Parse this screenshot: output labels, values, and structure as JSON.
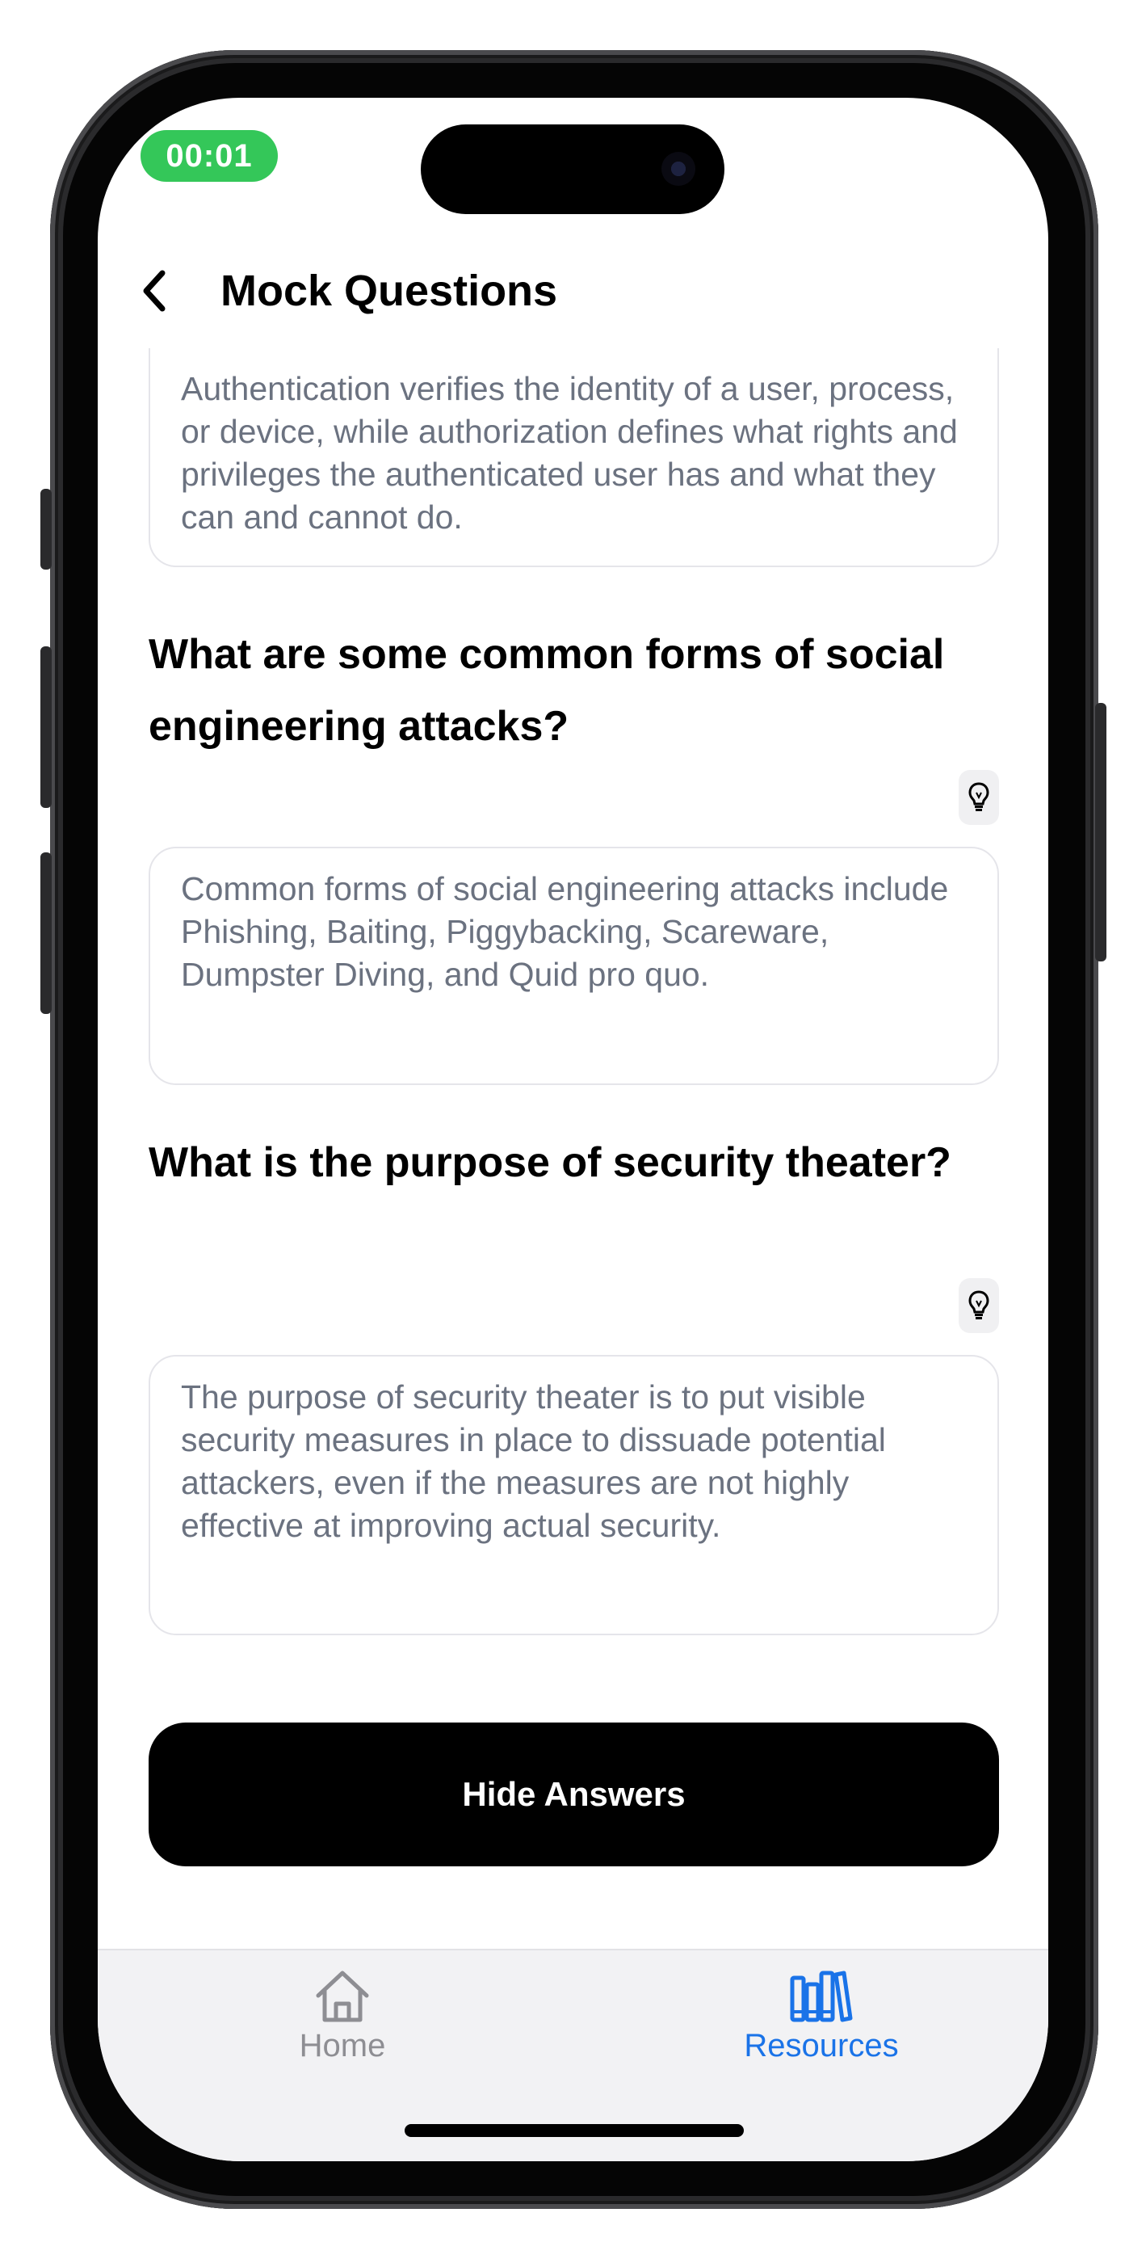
{
  "status": {
    "timer": "00:01"
  },
  "nav": {
    "title": "Mock Questions"
  },
  "qa": [
    {
      "question": "",
      "answer": "Authentication verifies the identity of a user, process, or device, while authorization defines what rights and privileges the authenticated user has and what they can and cannot do."
    },
    {
      "question": "What are some common forms of social engineering attacks?",
      "answer": "Common forms of social engineering attacks include Phishing, Baiting, Piggybacking, Scareware, Dumpster Diving, and Quid pro quo."
    },
    {
      "question": "What is the purpose of security theater?",
      "answer": "The purpose of security theater is to put visible security measures in place to dissuade potential attackers, even if the measures are not highly effective at improving actual security."
    }
  ],
  "actions": {
    "toggle_answers": "Hide Answers"
  },
  "tabs": [
    {
      "label": "Home",
      "icon": "house-icon",
      "active": false
    },
    {
      "label": "Resources",
      "icon": "books-icon",
      "active": true
    }
  ],
  "colors": {
    "accent": "#1a73e8",
    "timer": "#34c759",
    "answer_text": "#6b7280",
    "tab_inactive": "#8e8e93"
  }
}
